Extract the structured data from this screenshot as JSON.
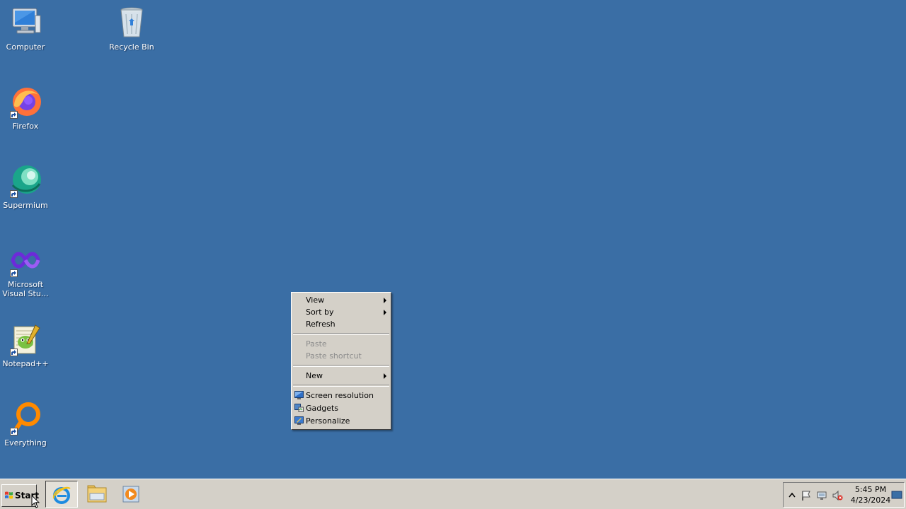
{
  "desktop": {
    "background_color": "#3a6ea5",
    "icons": [
      {
        "label": "Computer",
        "icon": "computer-icon"
      },
      {
        "label": "Recycle Bin",
        "icon": "recycle-bin-icon"
      },
      {
        "label": "Firefox",
        "icon": "firefox-icon"
      },
      {
        "label": "Supermium",
        "icon": "supermium-icon"
      },
      {
        "label": "Microsoft\nVisual Stu…",
        "icon": "visual-studio-icon"
      },
      {
        "label": "Notepad++",
        "icon": "notepadpp-icon"
      },
      {
        "label": "Everything",
        "icon": "everything-icon"
      }
    ]
  },
  "context_menu": {
    "items": [
      {
        "label": "View",
        "submenu": true,
        "enabled": true
      },
      {
        "label": "Sort by",
        "submenu": true,
        "enabled": true
      },
      {
        "label": "Refresh",
        "submenu": false,
        "enabled": true
      },
      {
        "label": "Paste",
        "submenu": false,
        "enabled": false
      },
      {
        "label": "Paste shortcut",
        "submenu": false,
        "enabled": false
      },
      {
        "label": "New",
        "submenu": true,
        "enabled": true
      },
      {
        "label": "Screen resolution",
        "icon": "screen-resolution-icon",
        "enabled": true
      },
      {
        "label": "Gadgets",
        "icon": "gadgets-icon",
        "enabled": true
      },
      {
        "label": "Personalize",
        "icon": "personalize-icon",
        "enabled": true
      }
    ]
  },
  "taskbar": {
    "start_label": "Start",
    "pinned_apps": [
      {
        "name": "internet-explorer-icon"
      },
      {
        "name": "file-explorer-icon"
      },
      {
        "name": "media-player-icon"
      }
    ],
    "tray": {
      "icons": [
        "show-hidden-icons-icon",
        "action-center-flag-icon",
        "network-icon",
        "volume-muted-icon"
      ],
      "time": "5:45 PM",
      "date": "4/23/2024"
    }
  }
}
